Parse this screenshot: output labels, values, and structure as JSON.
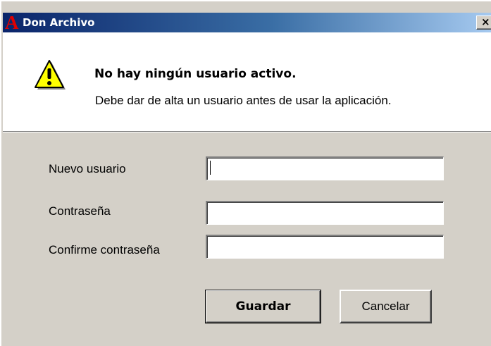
{
  "window": {
    "title": "Don Archivo",
    "app_icon_glyph": "A",
    "close_glyph": "×"
  },
  "message": {
    "icon": "warning-icon",
    "title": "No hay ningún usuario activo.",
    "body": "Debe dar de alta un usuario antes de usar la aplicación."
  },
  "form": {
    "new_user_label": "Nuevo usuario",
    "new_user_value": "",
    "password_label": "Contraseña",
    "password_value": "",
    "confirm_label": "Confirme contraseña",
    "confirm_value": ""
  },
  "buttons": {
    "save_label": "Guardar",
    "cancel_label": "Cancelar"
  },
  "colors": {
    "dialog_face": "#d4d0c8",
    "title_gradient_start": "#0a246a",
    "title_gradient_end": "#a6caf0",
    "app_icon": "#e00000",
    "warning_fill": "#ffff00"
  }
}
